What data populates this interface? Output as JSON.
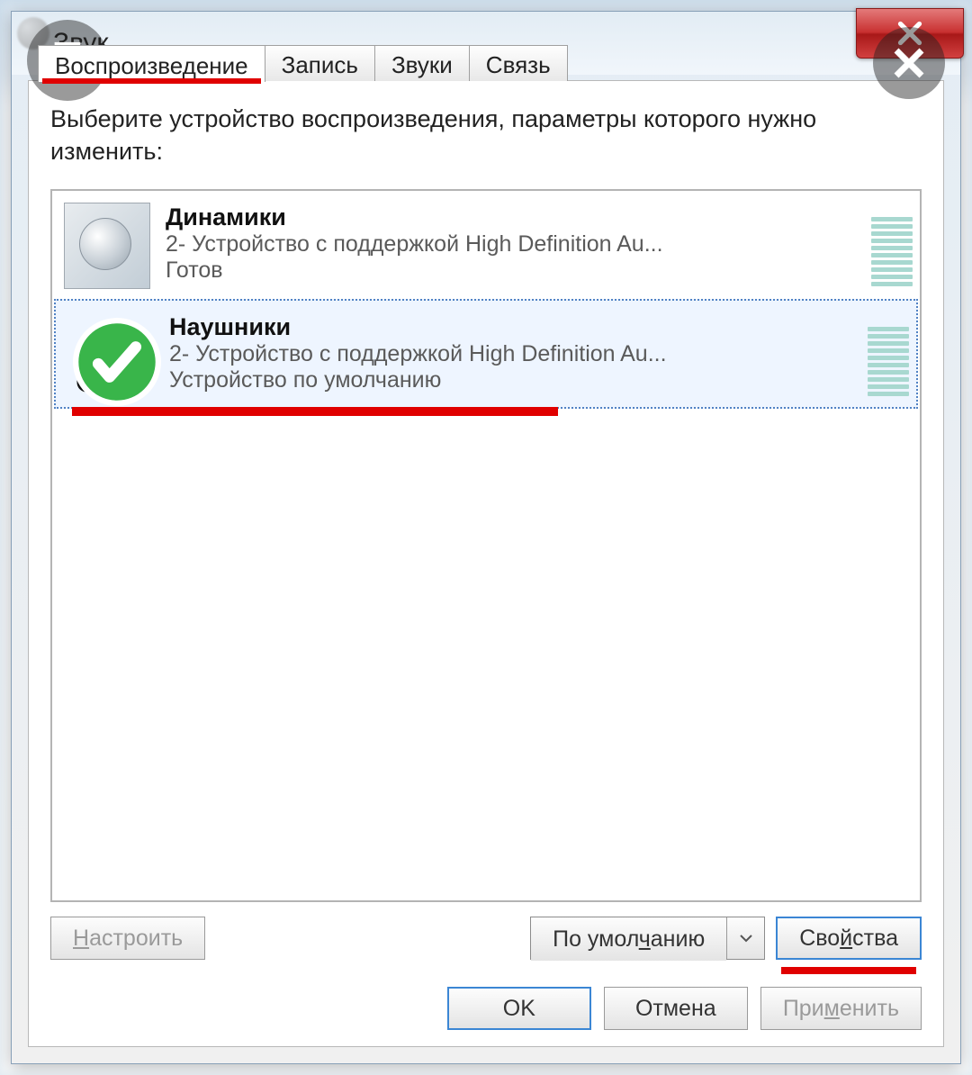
{
  "window": {
    "title": "Звук"
  },
  "tabs": [
    {
      "label": "Воспроизведение",
      "active": true,
      "highlighted": true
    },
    {
      "label": "Запись",
      "active": false
    },
    {
      "label": "Звуки",
      "active": false
    },
    {
      "label": "Связь",
      "active": false
    }
  ],
  "instruction": "Выберите устройство воспроизведения, параметры которого нужно изменить:",
  "devices": [
    {
      "name": "Динамики",
      "description": "2- Устройство с поддержкой High Definition Au...",
      "status": "Готов",
      "icon": "speaker-icon",
      "default": false,
      "selected": false
    },
    {
      "name": "Наушники",
      "description": "2- Устройство с поддержкой High Definition Au...",
      "status": "Устройство по умолчанию",
      "icon": "headphones-icon",
      "default": true,
      "selected": true,
      "highlighted": true
    }
  ],
  "buttons": {
    "configure": "Настроить",
    "set_default": "По умолчанию",
    "properties": "Свойства",
    "ok": "OK",
    "cancel": "Отмена",
    "apply": "Применить"
  },
  "annotations": {
    "properties_highlighted": true
  }
}
